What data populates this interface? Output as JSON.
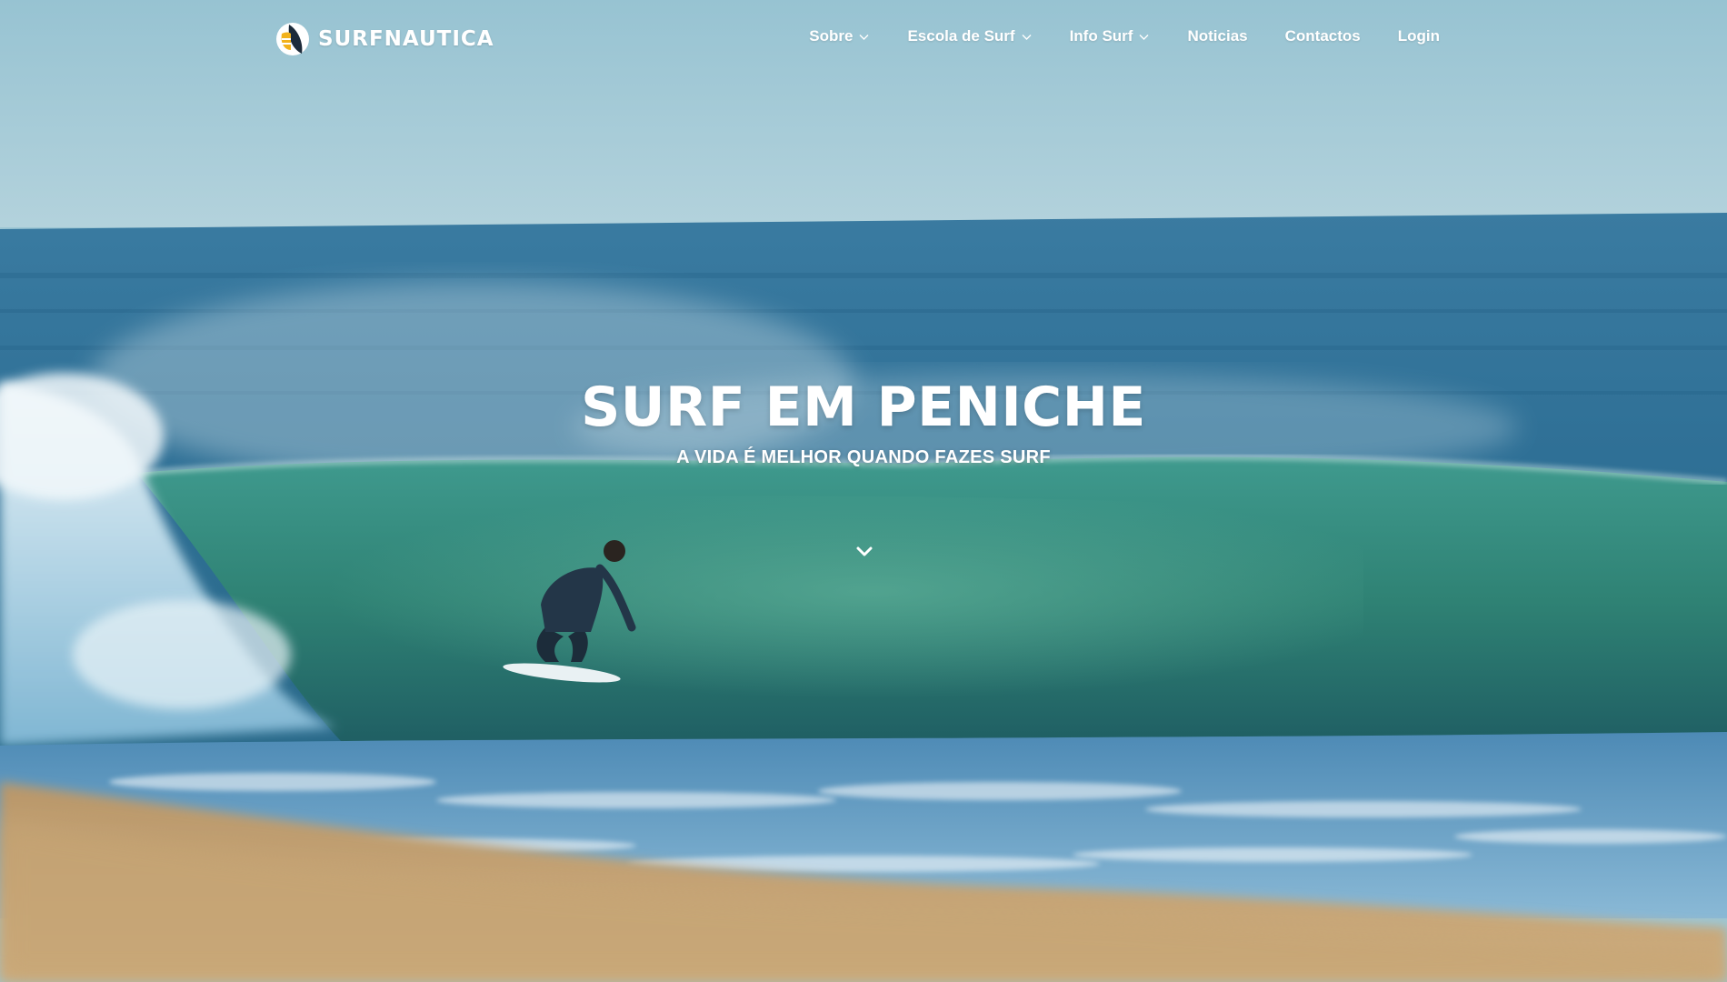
{
  "brand": {
    "name": "SURFNAUTICA",
    "logo_icon": "surfboard-sail-logo",
    "accent_color": "#f2b21b"
  },
  "nav": {
    "items": [
      {
        "label": "Sobre",
        "has_dropdown": true
      },
      {
        "label": "Escola de Surf",
        "has_dropdown": true
      },
      {
        "label": "Info Surf",
        "has_dropdown": true
      },
      {
        "label": "Noticias",
        "has_dropdown": false
      },
      {
        "label": "Contactos",
        "has_dropdown": false
      },
      {
        "label": "Login",
        "has_dropdown": false
      }
    ],
    "dropdown_icon": "chevron-down-icon"
  },
  "hero": {
    "title": "SURF EM PENICHE",
    "subtitle": "A VIDA É MELHOR QUANDO FAZES SURF",
    "scroll_icon": "chevron-down-icon"
  },
  "colors": {
    "sky": "#9ec7d5",
    "ocean": "#2e6f94",
    "wave": "#3e8f86",
    "sand": "#c9a978",
    "text": "#ffffff"
  }
}
